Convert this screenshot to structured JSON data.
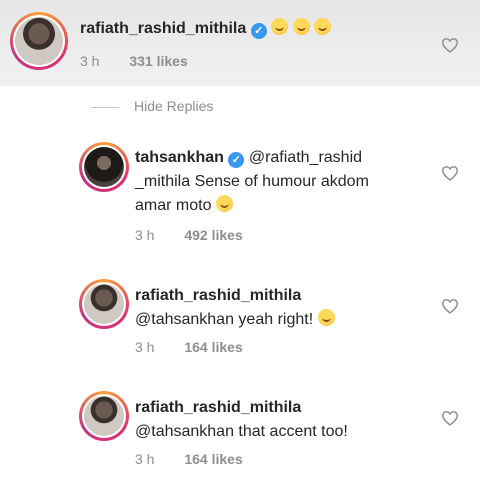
{
  "comments": [
    {
      "username": "rafiath_rashid_mithila",
      "text": "",
      "time": "3 h",
      "likes": "331 likes",
      "emoji_count": 3
    },
    {
      "username": "tahsankhan",
      "text_line1": "@rafiath_rashid",
      "text_line2": "_mithila Sense of humour akdom",
      "text_line3": "amar moto",
      "time": "3 h",
      "likes": "492 likes"
    },
    {
      "username": "rafiath_rashid_mithila",
      "text": "@tahsankhan yeah right!",
      "time": "3 h",
      "likes": "164 likes"
    },
    {
      "username": "rafiath_rashid_mithila",
      "text": "@tahsankhan that accent too!",
      "time": "3 h",
      "likes": "164 likes"
    }
  ],
  "hide_replies": "Hide Replies",
  "colors": {
    "verified": "#3897f0",
    "secondary_text": "#8e8e8e",
    "ring_gradient": [
      "#f9a13a",
      "#e1306c",
      "#c13584"
    ]
  },
  "icons": [
    "verified-icon",
    "heart-icon",
    "emoji-icon"
  ]
}
